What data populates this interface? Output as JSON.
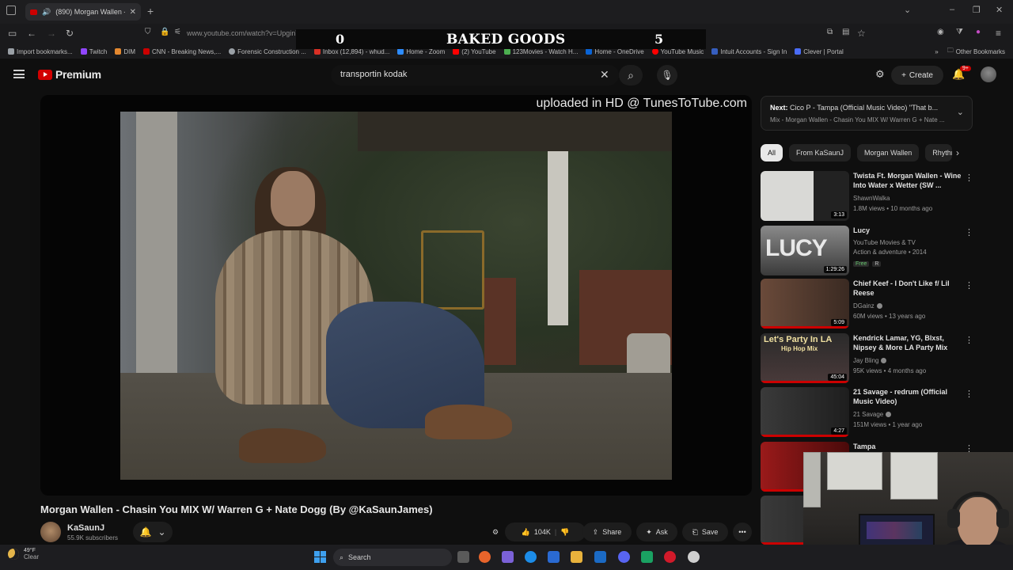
{
  "browser": {
    "tab_title": "(890) Morgan Wallen - Chas",
    "url": "www.youtube.com/watch?v=UpginTU3zHs&list=RDUpginTU3zHs&start_radio=1",
    "bookmarks": [
      {
        "label": "Import bookmarks...",
        "color": "#9aa0a6"
      },
      {
        "label": "Twitch",
        "color": "#9146ff"
      },
      {
        "label": "DIM",
        "color": "#e4882f"
      },
      {
        "label": "CNN - Breaking News,...",
        "color": "#cc0000"
      },
      {
        "label": "Forensic Construction ...",
        "color": "#9aa0a6"
      },
      {
        "label": "Inbox (12,894) - whud...",
        "color": "#d93025"
      },
      {
        "label": "Home - Zoom",
        "color": "#2d8cff"
      },
      {
        "label": "(2) YouTube",
        "color": "#ff0000"
      },
      {
        "label": "123Movies - Watch H...",
        "color": "#4caf50"
      },
      {
        "label": "Home - OneDrive",
        "color": "#0a64d6"
      },
      {
        "label": "YouTube Music",
        "color": "#ff0000"
      },
      {
        "label": "Intuit Accounts - Sign In",
        "color": "#365ebf"
      },
      {
        "label": "Clever | Portal",
        "color": "#4a6cf7"
      }
    ],
    "other_bookmarks": "Other Bookmarks"
  },
  "overlay": {
    "left_score": "0",
    "title": "BAKED GOODS",
    "right_score": "5"
  },
  "youtube": {
    "logo_text": "Premium",
    "search_query": "transportin kodak",
    "create_label": "Create",
    "notif_count": "9+"
  },
  "video": {
    "watermark": "uploaded in HD @ TunesToTube.com",
    "title": "Morgan Wallen - Chasin You MIX W/ Warren G + Nate Dogg (By @KaSaunJames)",
    "channel": "KaSaunJ",
    "subscribers": "55.9K subscribers",
    "likes": "104K",
    "share_label": "Share",
    "ask_label": "Ask",
    "save_label": "Save"
  },
  "next": {
    "label": "Next:",
    "title": "Cico P - Tampa (Official Music Video) \"That b...",
    "playlist": "Mix - Morgan Wallen - Chasin You MIX W/ Warren G + Nate ..."
  },
  "chips": [
    "All",
    "From KaSaunJ",
    "Morgan Wallen",
    "Rhythm"
  ],
  "recommendations": [
    {
      "title": "Twista Ft. Morgan Wallen - Wine Into Water x Wetter (SW ...",
      "channel": "ShawnWalka",
      "meta": "1.8M views • 10 months ago",
      "duration": "3:13",
      "verified": false,
      "thumb_bg": "#cfcfcf",
      "bar": 0
    },
    {
      "title": "Lucy",
      "channel": "YouTube Movies & TV",
      "meta": "Action & adventure • 2014",
      "duration": "1:29:26",
      "free": "Free",
      "rating": "R",
      "thumb_bg": "#6f6f6f",
      "bar": 0
    },
    {
      "title": "Chief Keef - I Don't Like f/ Lil Reese",
      "channel": "DGainz",
      "meta": "60M views • 13 years ago",
      "duration": "5:09",
      "verified": true,
      "thumb_bg": "#5a3a30",
      "bar": 1
    },
    {
      "title": "Kendrick Lamar, YG, Blxst, Nipsey & More LA Party Mix",
      "channel": "Jay Bling",
      "meta": "95K views • 4 months ago",
      "duration": "45:04",
      "verified": true,
      "thumb_bg": "#2a2a2a",
      "bar": 1
    },
    {
      "title": "21 Savage - redrum (Official Music Video)",
      "channel": "21 Savage",
      "meta": "151M views • 1 year ago",
      "duration": "4:27",
      "verified": true,
      "thumb_bg": "#3a3a3a",
      "bar": 1
    },
    {
      "title": "Tampa",
      "channel": "",
      "meta": "",
      "duration": "",
      "thumb_bg": "#8a1010",
      "bar": 1
    },
    {
      "title": "",
      "channel": "",
      "meta": "",
      "duration": "",
      "thumb_bg": "#2e2e2e",
      "bar": 1
    }
  ],
  "taskbar": {
    "temperature": "49°F",
    "condition": "Clear",
    "search_placeholder": "Search"
  }
}
